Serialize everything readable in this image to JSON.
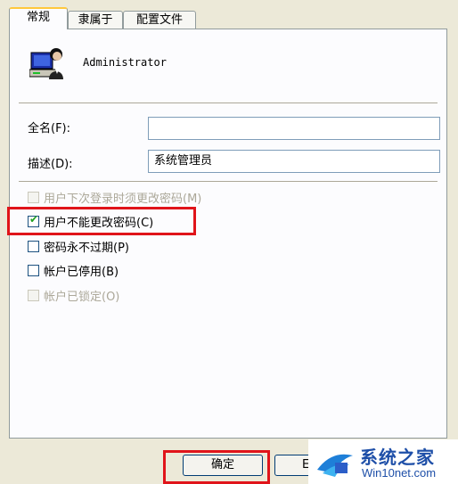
{
  "tabs": [
    "常规",
    "隶属于",
    "配置文件"
  ],
  "user": {
    "name": "Administrator",
    "icon": "user-computer-icon"
  },
  "fields": {
    "full_name": {
      "label": "全名(F):",
      "value": ""
    },
    "description": {
      "label": "描述(D):",
      "value": "系统管理员"
    }
  },
  "options": [
    {
      "label": "用户下次登录时须更改密码(M)",
      "checked": false,
      "enabled": false
    },
    {
      "label": "用户不能更改密码(C)",
      "checked": true,
      "enabled": true
    },
    {
      "label": "密码永不过期(P)",
      "checked": false,
      "enabled": true
    },
    {
      "label": "帐户已停用(B)",
      "checked": false,
      "enabled": true
    },
    {
      "label": "帐户已锁定(O)",
      "checked": false,
      "enabled": false
    }
  ],
  "buttons": {
    "ok": "确定",
    "cancel_partial": "E"
  },
  "watermark": {
    "brand": "系统之家",
    "site": "Win10net.com"
  },
  "colors": {
    "highlight": "#E0141A",
    "tab_accent": "#FFC83C",
    "check": "#21A121"
  }
}
